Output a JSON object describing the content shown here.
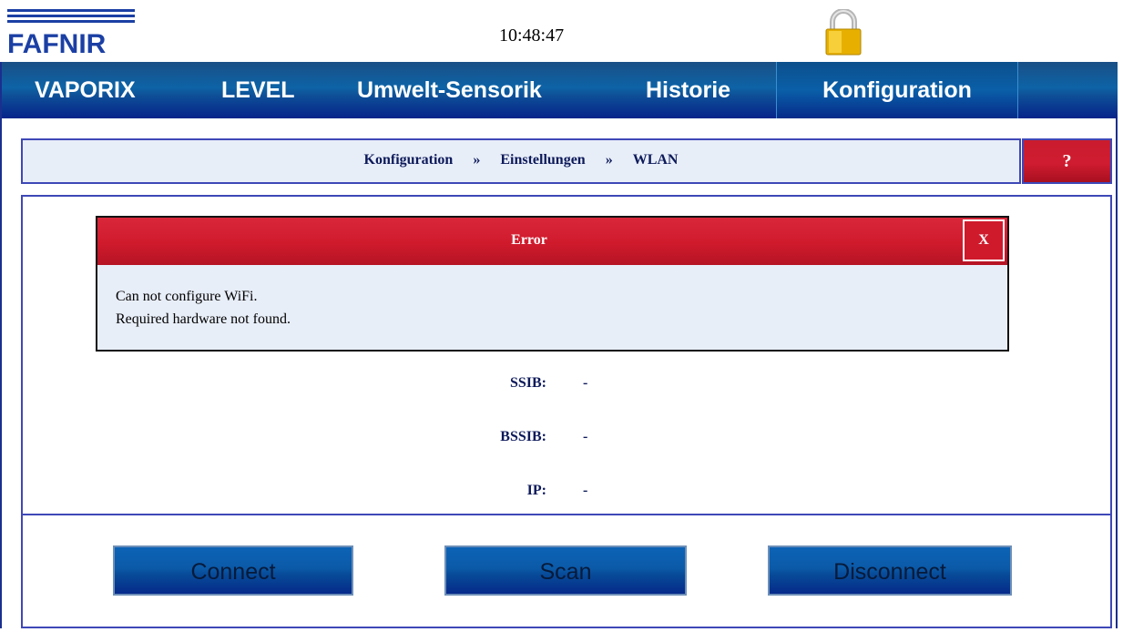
{
  "header": {
    "logo_text": "FAFNIR",
    "time": "10:48:47",
    "lock_icon": "padlock-icon"
  },
  "nav": {
    "items": [
      {
        "label": "VAPORIX"
      },
      {
        "label": "LEVEL"
      },
      {
        "label": "Umwelt-Sensorik"
      },
      {
        "label": "Historie"
      },
      {
        "label": "Konfiguration",
        "active": true
      }
    ]
  },
  "breadcrumb": {
    "parts": [
      "Konfiguration",
      "»",
      "Einstellungen",
      "»",
      "WLAN"
    ],
    "help_label": "?"
  },
  "dialog": {
    "title": "Error",
    "close_label": "X",
    "message_line1": "Can not configure WiFi.",
    "message_line2": "Required hardware not found."
  },
  "fields": [
    {
      "label": "SSIB:",
      "value": "-"
    },
    {
      "label": "BSSIB:",
      "value": "-"
    },
    {
      "label": "IP:",
      "value": "-"
    }
  ],
  "buttons": {
    "connect": "Connect",
    "scan": "Scan",
    "disconnect": "Disconnect"
  },
  "colors": {
    "nav_blue": "#0d63a6",
    "error_red": "#cf1a2c",
    "panel_bg": "#e8eef8",
    "border_blue": "#3e48b7"
  }
}
